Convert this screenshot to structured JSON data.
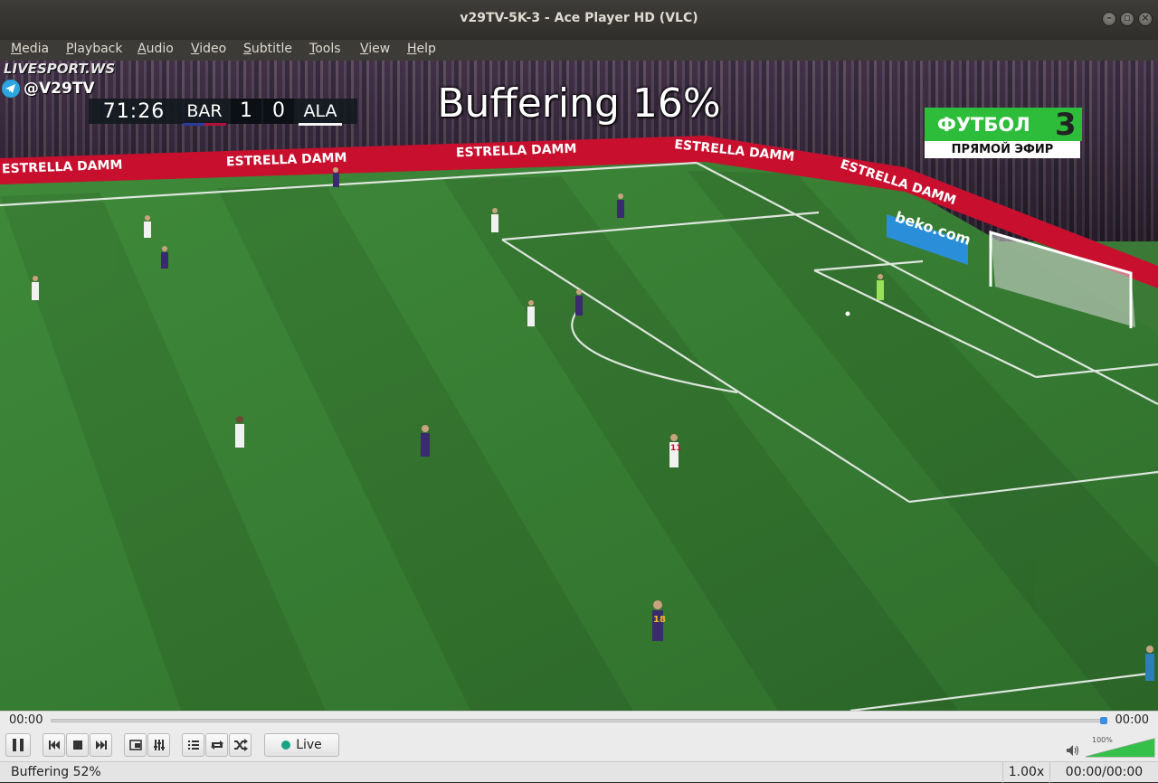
{
  "window": {
    "title": "v29TV-5K-3 - Ace Player HD (VLC)"
  },
  "menu": [
    {
      "label": "Media",
      "mnemonic": "M",
      "rest": "edia"
    },
    {
      "label": "Playback",
      "mnemonic": "P",
      "rest": "layback"
    },
    {
      "label": "Audio",
      "mnemonic": "A",
      "rest": "udio"
    },
    {
      "label": "Video",
      "mnemonic": "V",
      "rest": "ideo"
    },
    {
      "label": "Subtitle",
      "mnemonic": "S",
      "rest": "ubtitle"
    },
    {
      "label": "Tools",
      "mnemonic": "T",
      "rest": "ools"
    },
    {
      "label": "View",
      "mnemonic": "V",
      "rest": "iew"
    },
    {
      "label": "Help",
      "mnemonic": "H",
      "rest": "elp"
    }
  ],
  "video": {
    "osd": "Buffering 16%",
    "watermark_site": "LIVESPORT.WS",
    "watermark_channel": "@V29TV",
    "scoreboard": {
      "time": "71:26",
      "home": "BAR",
      "home_score": "1",
      "away_score": "0",
      "away": "ALA"
    },
    "channel_logo": {
      "name": "ФУТБОЛ",
      "number": "3",
      "subtitle": "ПРЯМОЙ ЭФИР"
    },
    "ads": {
      "estrella": "ESTRELLA DAMM",
      "beko": "beko.com"
    },
    "shirt_numbers": [
      "18",
      "11"
    ]
  },
  "controls": {
    "elapsed": "00:00",
    "total": "00:00",
    "seek_fraction": 1.0,
    "live_label": "Live",
    "volume_percent": "100%",
    "volume_level": 1.0,
    "icons": [
      "pause-icon",
      "previous-icon",
      "stop-icon",
      "next-icon",
      "fullscreen-icon",
      "extended-settings-icon",
      "playlist-icon",
      "loop-icon",
      "random-icon",
      "volume-icon"
    ]
  },
  "status": {
    "message": "Buffering 52%",
    "speed": "1.00x",
    "time": "00:00/00:00"
  },
  "colors": {
    "pitch": "#3a7a36",
    "ad_red": "#c8102e",
    "channel_green": "#2dbd3a",
    "live_dot": "#19a48a",
    "seek_handle": "#3a8fe0",
    "volume_green": "#35c04a"
  }
}
